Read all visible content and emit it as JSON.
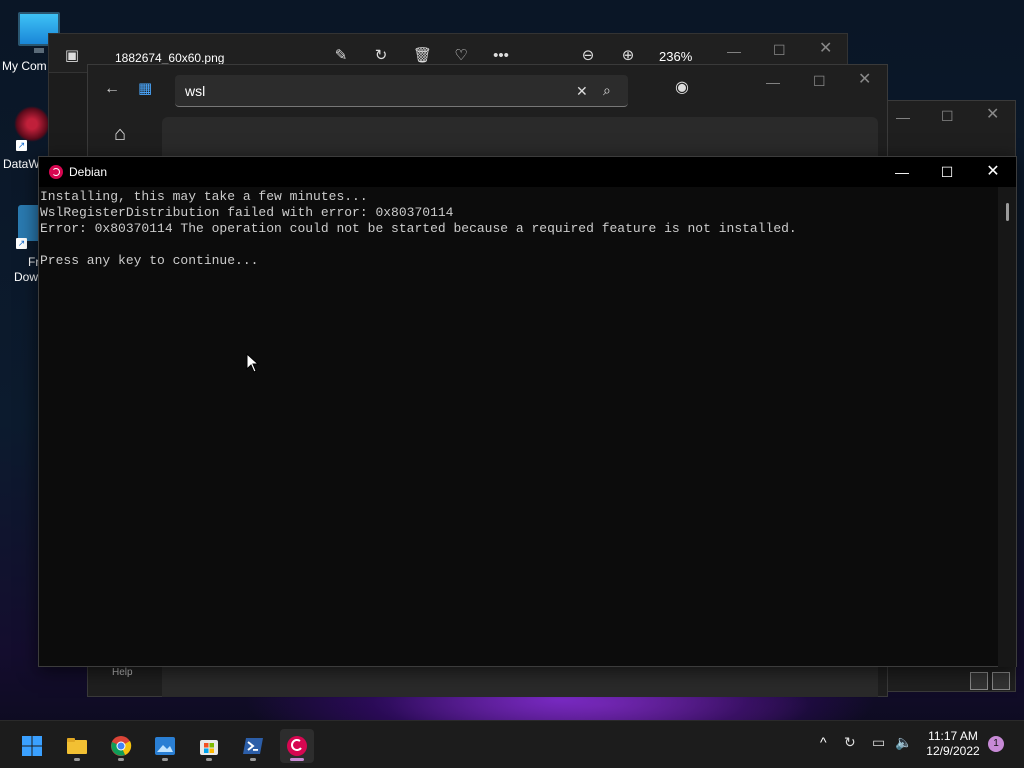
{
  "desktop": {
    "icons": [
      {
        "label": "My Com"
      },
      {
        "label": "DataW"
      },
      {
        "label": "Fr"
      },
      {
        "label": "Dow"
      }
    ]
  },
  "photos_window": {
    "filename": "1882674_60x60.png",
    "zoom": "236%"
  },
  "store_window": {
    "search_value": "wsl",
    "help_label": "Help"
  },
  "console": {
    "title": "Debian",
    "lines": [
      "Installing, this may take a few minutes...",
      "WslRegisterDistribution failed with error: 0x80370114",
      "Error: 0x80370114 The operation could not be started because a required feature is not installed.",
      "",
      "Press any key to continue..."
    ]
  },
  "taskbar": {
    "time": "11:17 AM",
    "date": "12/9/2022",
    "notification_count": "1",
    "apps": [
      "start-icon",
      "file-explorer-icon",
      "chrome-icon",
      "photos-icon",
      "store-icon",
      "powershell-icon",
      "debian-icon"
    ]
  },
  "colors": {
    "debian_red": "#d70751",
    "console_bg": "#0c0c0c",
    "console_text": "#cccccc",
    "taskbar_bg": "#1c1c1c"
  }
}
